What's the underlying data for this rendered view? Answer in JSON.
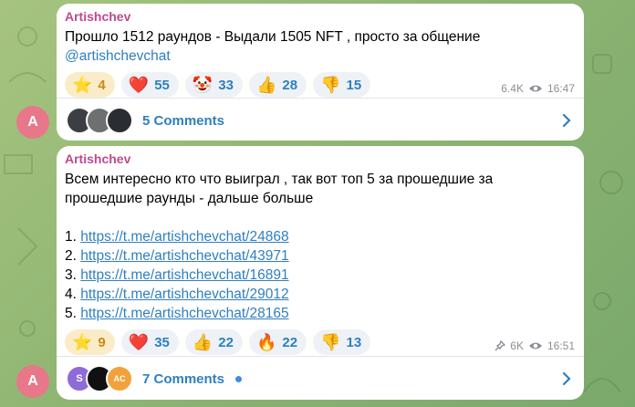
{
  "messages": [
    {
      "sender": "Artishchev",
      "text_line1": "Прошло 1512 раундов - Выдали 1505 NFT , просто за общение",
      "mention": "@artishchevchat",
      "reactions": [
        {
          "emoji": "⭐",
          "count": "4",
          "kind": "star"
        },
        {
          "emoji": "❤️",
          "count": "55"
        },
        {
          "emoji": "🤡",
          "count": "33"
        },
        {
          "emoji": "👍",
          "count": "28"
        },
        {
          "emoji": "👎",
          "count": "15"
        }
      ],
      "views": "6.4K",
      "time": "16:47",
      "comments_label": "5 Comments",
      "avatar_letter": "A"
    },
    {
      "sender": "Artishchev",
      "text": "Всем интересно кто что выиграл , так вот топ 5 за прошедшие за прошедшие раунды - дальше больше",
      "links": [
        {
          "num": "1.",
          "url": "https://t.me/artishchevchat/24868"
        },
        {
          "num": "2.",
          "url": "https://t.me/artishchevchat/43971"
        },
        {
          "num": "3.",
          "url": "https://t.me/artishchevchat/16891"
        },
        {
          "num": "4.",
          "url": "https://t.me/artishchevchat/29012"
        },
        {
          "num": "5.",
          "url": "https://t.me/artishchevchat/28165"
        }
      ],
      "reactions": [
        {
          "emoji": "⭐",
          "count": "9",
          "kind": "star"
        },
        {
          "emoji": "❤️",
          "count": "35"
        },
        {
          "emoji": "👍",
          "count": "22"
        },
        {
          "emoji": "🔥",
          "count": "22"
        },
        {
          "emoji": "👎",
          "count": "13"
        }
      ],
      "views": "6K",
      "time": "16:51",
      "comments_label": "7 Comments",
      "avatar_letter": "A",
      "mini_avatars": [
        "S",
        "",
        "AC"
      ]
    }
  ],
  "colors": {
    "accent": "#2f7fbf",
    "sender": "#c04a8a",
    "avatar": "#e8778a",
    "unread_dot": "#3a8ee6"
  }
}
